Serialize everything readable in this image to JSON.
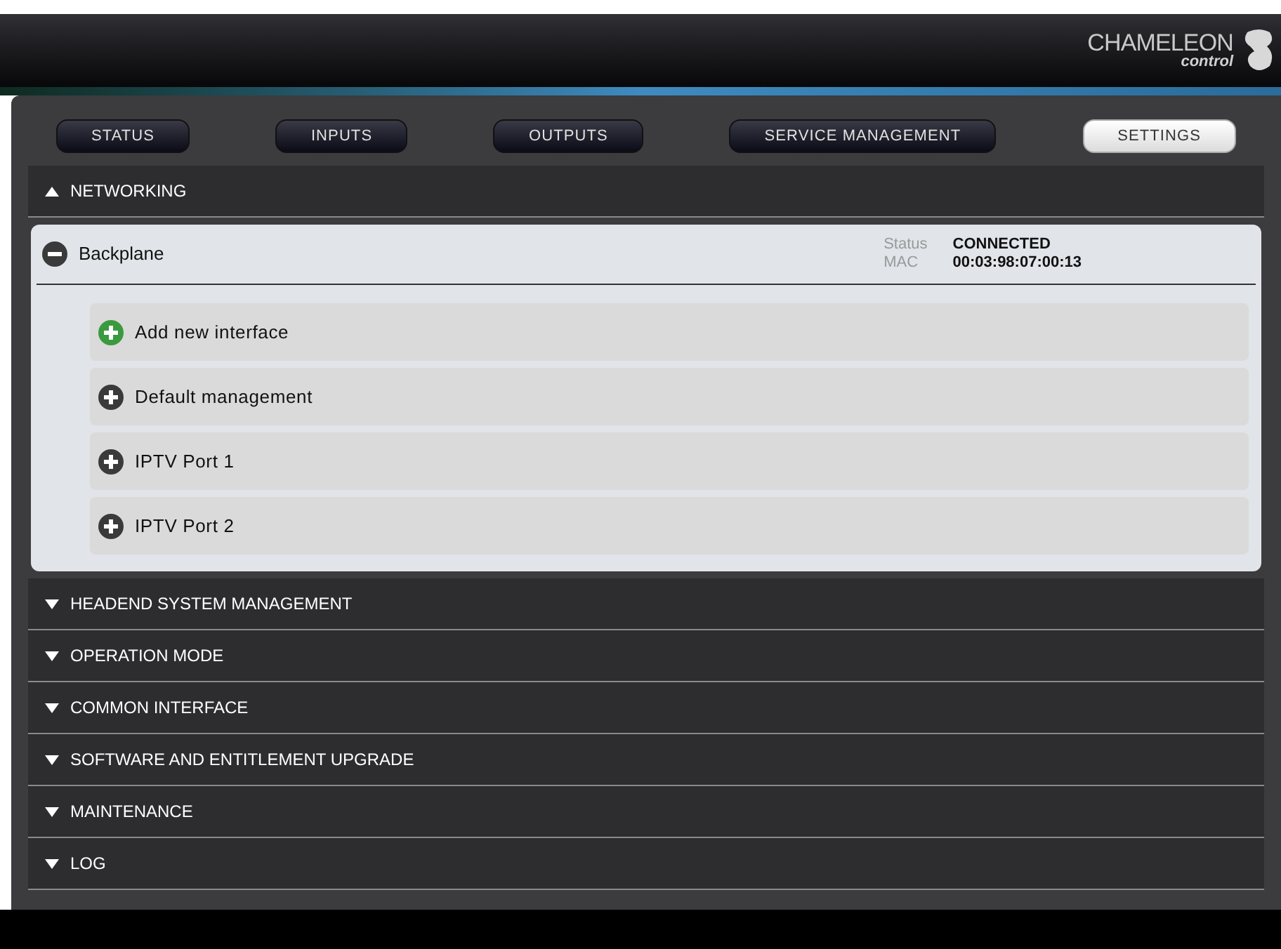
{
  "brand": {
    "name": "CHAMELEON",
    "sub": "control"
  },
  "tabs": [
    {
      "label": "STATUS",
      "selected": false
    },
    {
      "label": "INPUTS",
      "selected": false
    },
    {
      "label": "OUTPUTS",
      "selected": false
    },
    {
      "label": "SERVICE MANAGEMENT",
      "selected": false
    },
    {
      "label": "SETTINGS",
      "selected": true
    }
  ],
  "sections": [
    {
      "title": "NETWORKING",
      "expanded": true,
      "interface": {
        "name": "Backplane",
        "expanded": true,
        "status_label": "Status",
        "status": "CONNECTED",
        "mac_label": "MAC",
        "mac": "00:03:98:07:00:13",
        "items": [
          {
            "label": "Add new interface",
            "kind": "add"
          },
          {
            "label": "Default management",
            "kind": "item"
          },
          {
            "label": "IPTV Port 1",
            "kind": "item"
          },
          {
            "label": "IPTV Port 2",
            "kind": "item"
          }
        ]
      }
    },
    {
      "title": "HEADEND SYSTEM MANAGEMENT",
      "expanded": false
    },
    {
      "title": "OPERATION MODE",
      "expanded": false
    },
    {
      "title": "COMMON INTERFACE",
      "expanded": false
    },
    {
      "title": "SOFTWARE AND ENTITLEMENT UPGRADE",
      "expanded": false
    },
    {
      "title": "MAINTENANCE",
      "expanded": false
    },
    {
      "title": "LOG",
      "expanded": false
    }
  ]
}
